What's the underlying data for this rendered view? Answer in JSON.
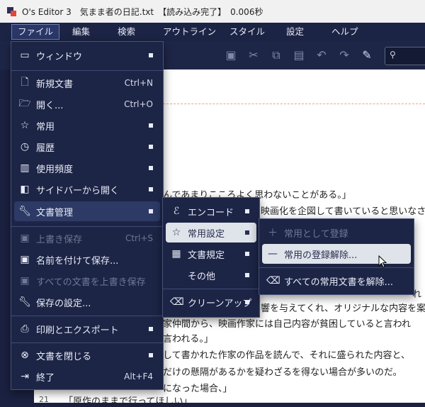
{
  "window": {
    "title": "O's Editor 3　気まま者の日記.txt　【読み込み完了】　0.006秒"
  },
  "menubar": [
    "ファイル",
    "編集",
    "検索",
    "アウトライン",
    "スタイル",
    "設定",
    "ヘルプ"
  ],
  "file_menu": {
    "items": [
      {
        "label": "ウィンドウ",
        "icon": "window-icon"
      },
      {
        "label": "新規文書",
        "icon": "new-document-icon",
        "shortcut": "Ctrl+N"
      },
      {
        "label": "開く...",
        "icon": "folder-open-icon",
        "shortcut": "Ctrl+O"
      },
      {
        "label": "常用",
        "icon": "star-icon"
      },
      {
        "label": "履歴",
        "icon": "clock-icon"
      },
      {
        "label": "使用頻度",
        "icon": "library-icon"
      },
      {
        "label": "サイドバーから開く",
        "icon": "sidebar-icon"
      },
      {
        "label": "文書管理",
        "icon": "wrench-icon"
      },
      {
        "label": "上書き保存",
        "icon": "save-icon",
        "shortcut": "Ctrl+S"
      },
      {
        "label": "名前を付けて保存...",
        "icon": "save-as-icon"
      },
      {
        "label": "すべての文書を上書き保存",
        "icon": "save-all-icon"
      },
      {
        "label": "保存の設定...",
        "icon": "wrench-icon"
      },
      {
        "label": "印刷とエクスポート",
        "icon": "print-export-icon"
      },
      {
        "label": "文書を閉じる",
        "icon": "close-circle-icon"
      },
      {
        "label": "終了",
        "icon": "exit-icon",
        "shortcut": "Alt+F4"
      }
    ]
  },
  "doc_menu": {
    "items": [
      {
        "label": "エンコード",
        "icon": "encoding-icon"
      },
      {
        "label": "常用設定",
        "icon": "star-icon"
      },
      {
        "label": "文書規定",
        "icon": "document-rule-icon"
      },
      {
        "label": "その他",
        "icon": ""
      },
      {
        "label": "クリーンアップ",
        "icon": "eraser-icon"
      }
    ]
  },
  "fav_menu": {
    "items": [
      {
        "label": "常用として登録",
        "icon": "plus-icon"
      },
      {
        "label": "常用の登録解除...",
        "icon": "minus-icon"
      },
      {
        "label": "すべての常用文書を解除...",
        "icon": "eraser-icon"
      }
    ]
  },
  "editor": {
    "lines": [
      "んであまりこころよく思わないことがある。」",
      "映画化を企図して書いていると思いなさ",
      "れ",
      "響を与えてくれ、オリジナルな内容を案",
      "家仲間から、映画作家には自己内容が貧困していると言われ",
      "言われる。」",
      "して書かれた作家の作品を読んで、それに盛られた内容と、",
      "だけの懸隔があるかを疑わざるを得ない場合が多いのだ。",
      "になった場合、」",
      "「原作のままで行ってほしい」"
    ],
    "line_number": "21"
  }
}
